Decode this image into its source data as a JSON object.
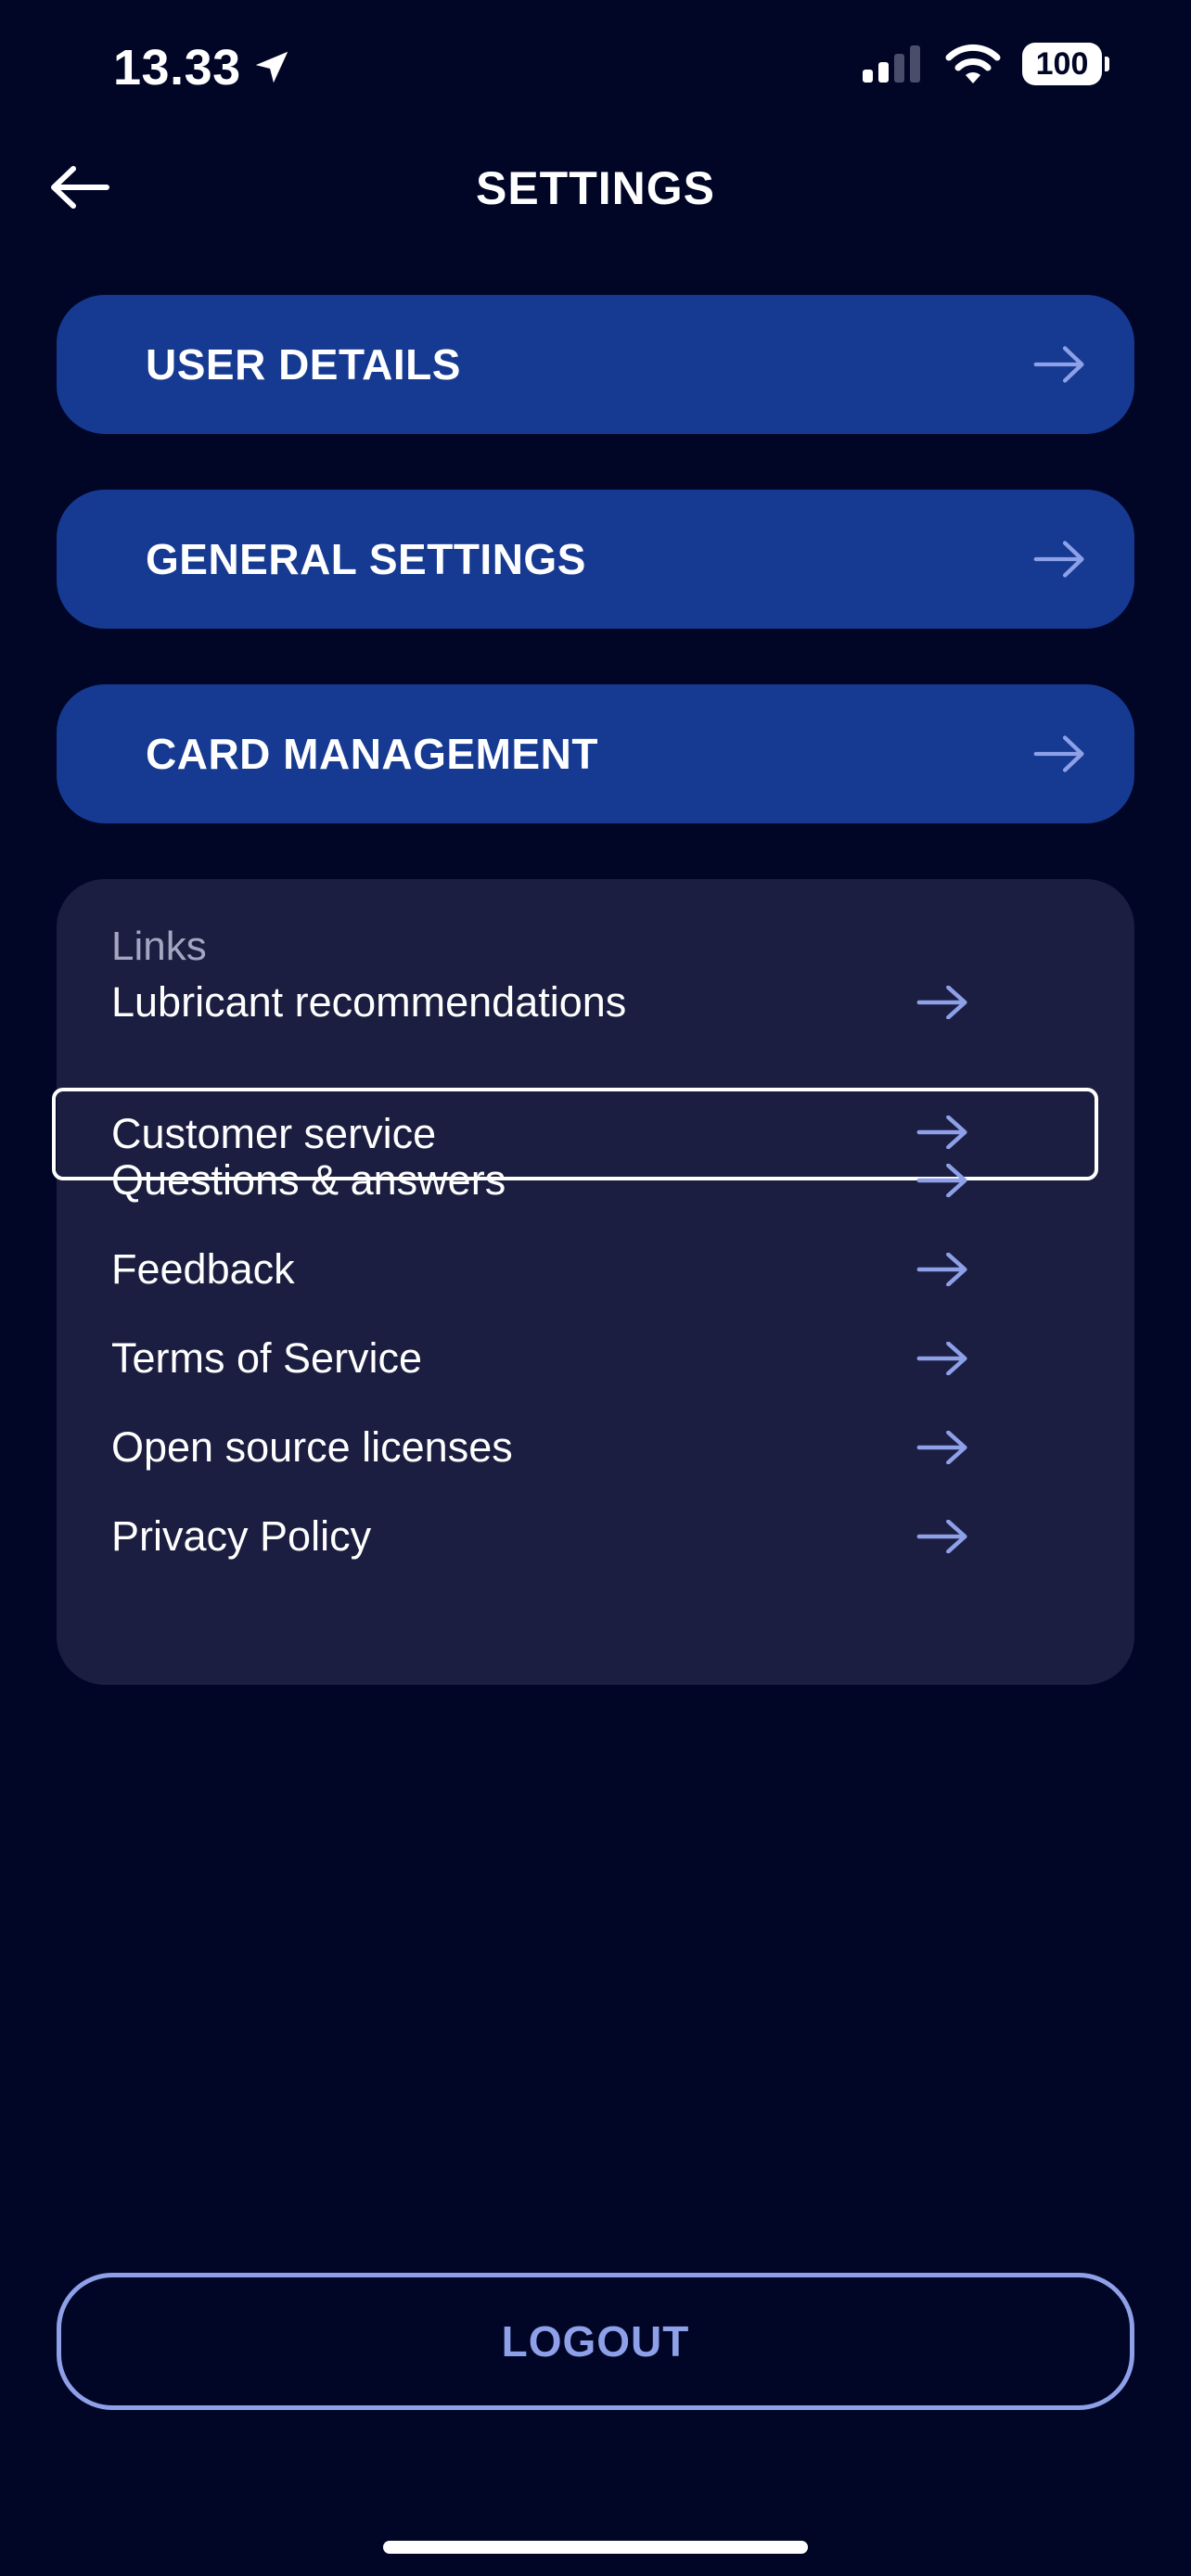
{
  "status_bar": {
    "time": "13.33",
    "battery": "100"
  },
  "header": {
    "title": "SETTINGS"
  },
  "nav": [
    {
      "label": "USER DETAILS"
    },
    {
      "label": "GENERAL SETTINGS"
    },
    {
      "label": "CARD MANAGEMENT"
    }
  ],
  "links": {
    "heading": "Links",
    "items": [
      {
        "label": "Lubricant recommendations"
      },
      {
        "label": "Customer service"
      },
      {
        "label": "Questions & answers"
      },
      {
        "label": "Feedback"
      },
      {
        "label": "Terms of Service"
      },
      {
        "label": "Open source licenses"
      },
      {
        "label": "Privacy Policy"
      }
    ]
  },
  "logout_label": "LOGOUT",
  "colors": {
    "background": "#010526",
    "primary_button": "#163a92",
    "card": "#1b1e40",
    "accent": "#8da0e8"
  },
  "icons": {
    "back": "arrow-left-icon",
    "item": "arrow-right-icon",
    "location": "location-arrow-icon",
    "signal": "cellular-signal-icon",
    "wifi": "wifi-icon",
    "battery": "battery-icon"
  }
}
